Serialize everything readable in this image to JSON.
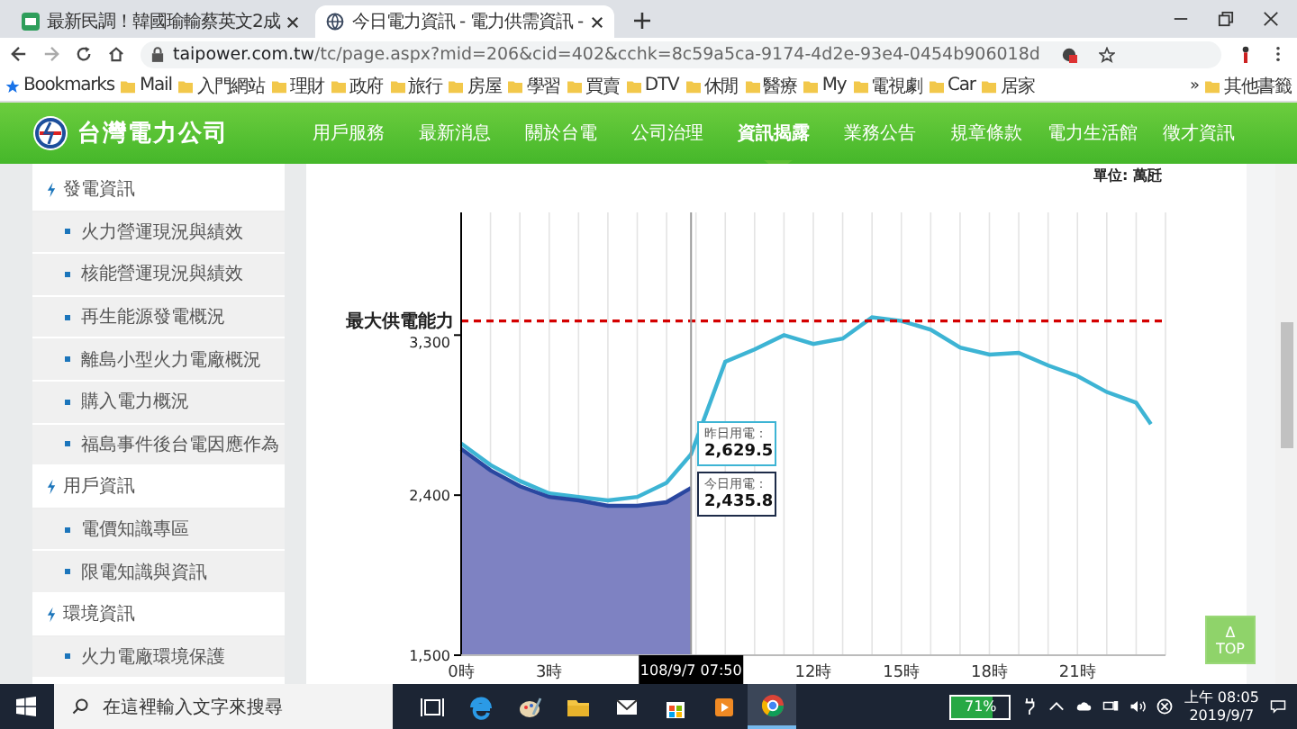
{
  "browser": {
    "tabs": [
      {
        "title": "最新民調！韓國瑜輸蔡英文2成",
        "selected": false
      },
      {
        "title": "今日電力資訊 - 電力供需資訊 -",
        "selected": true
      }
    ],
    "url_host": "taipower.com.tw",
    "url_path": "/tc/page.aspx?mid=206&cid=402&cchk=8c59a5ca-9174-4d2e-93e4-0454b906018d",
    "bookmarks_label": "Bookmarks",
    "bookmarks": [
      "Mail",
      "入門網站",
      "理財",
      "政府",
      "旅行",
      "房屋",
      "學習",
      "買賣",
      "DTV",
      "休閒",
      "醫療",
      "My",
      "電視劇",
      "Car",
      "居家"
    ],
    "more": "»",
    "other_bookmarks": "其他書籤"
  },
  "header": {
    "logo_text": "台灣電力公司",
    "nav": [
      {
        "label": "用戶服務",
        "selected": false
      },
      {
        "label": "最新消息",
        "selected": false
      },
      {
        "label": "關於台電",
        "selected": false
      },
      {
        "label": "公司治理",
        "selected": false
      },
      {
        "label": "資訊揭露",
        "selected": true
      },
      {
        "label": "業務公告",
        "selected": false
      },
      {
        "label": "規章條款",
        "selected": false
      },
      {
        "label": "電力生活館",
        "selected": false
      },
      {
        "label": "徵才資訊",
        "selected": false
      }
    ]
  },
  "sidebar": {
    "sections": [
      {
        "title": "發電資訊",
        "children": [
          {
            "label": "火力營運現況與績效"
          },
          {
            "label": "核能營運現況與績效"
          },
          {
            "label": "再生能源發電概況"
          },
          {
            "label": "離島小型火力電廠概況"
          },
          {
            "label": "購入電力概況"
          },
          {
            "label": "福島事件後台電因應作為"
          }
        ]
      },
      {
        "title": "用戶資訊",
        "children": [
          {
            "label": "電價知識專區"
          },
          {
            "label": "限電知識與資訊"
          }
        ]
      },
      {
        "title": "環境資訊",
        "children": [
          {
            "label": "火力電廠環境保護"
          }
        ]
      }
    ]
  },
  "chart_panel": {
    "unit": "單位: 萬瓩",
    "tooltips": [
      {
        "label": "昨日用電：",
        "value": "2,629.5"
      },
      {
        "label": "今日用電：",
        "value": "2,435.8"
      }
    ],
    "chart_data": {
      "type": "line",
      "grid": true,
      "x": [
        0,
        1,
        2,
        3,
        4,
        5,
        6,
        7,
        7.8333,
        9,
        10,
        11,
        12,
        13,
        14,
        15,
        16,
        17,
        18,
        19,
        20,
        21,
        22,
        23,
        23.5
      ],
      "xlim": [
        0,
        24
      ],
      "ylim": [
        1500,
        3990
      ],
      "xticks": [
        {
          "value": 0,
          "label": "0時"
        },
        {
          "value": 3,
          "label": "3時"
        },
        {
          "value": 12,
          "label": "12時"
        },
        {
          "value": 15,
          "label": "15時"
        },
        {
          "value": 18,
          "label": "18時"
        },
        {
          "value": 21,
          "label": "21時"
        }
      ],
      "yticks": [
        {
          "value": 1500,
          "label": "1,500"
        },
        {
          "value": 2400,
          "label": "2,400"
        },
        {
          "value": 3300,
          "label": "3,300"
        }
      ],
      "series": [
        {
          "color": "#3db4d4",
          "values": [
            2690,
            2570,
            2480,
            2410,
            2390,
            2370,
            2390,
            2470,
            2630,
            3150,
            3220,
            3300,
            3250,
            3280,
            3400,
            3380,
            3330,
            3230,
            3190,
            3200,
            3130,
            3070,
            2980,
            2920,
            2800
          ]
        },
        {
          "color": "#2a47a0",
          "values": [
            2660,
            2540,
            2450,
            2390,
            2370,
            2340,
            2340,
            2360,
            2440,
            null,
            null,
            null,
            null,
            null,
            null,
            null,
            null,
            null,
            null,
            null,
            null,
            null,
            null,
            null,
            null
          ]
        }
      ],
      "ref_lines": [
        {
          "axis": "y",
          "value": 3380,
          "label": "最大供電能力",
          "color": "#d40000"
        },
        {
          "axis": "x",
          "value": 7.8333,
          "color": "#999999"
        }
      ]
    },
    "cursor_time": "108/9/7 07:50"
  },
  "top_button": {
    "icon": "Δ",
    "label": "TOP"
  },
  "taskbar": {
    "search_placeholder": "在這裡輸入文字來搜尋",
    "apps": [
      {
        "selected": false
      },
      {
        "selected": false
      },
      {
        "selected": false
      },
      {
        "selected": false
      },
      {
        "selected": false
      },
      {
        "selected": false
      },
      {
        "selected": false
      },
      {
        "selected": true
      }
    ],
    "battery": {
      "label": "71%",
      "level": 0.71
    },
    "time": "上午 08:05",
    "date": "2019/9/7"
  }
}
